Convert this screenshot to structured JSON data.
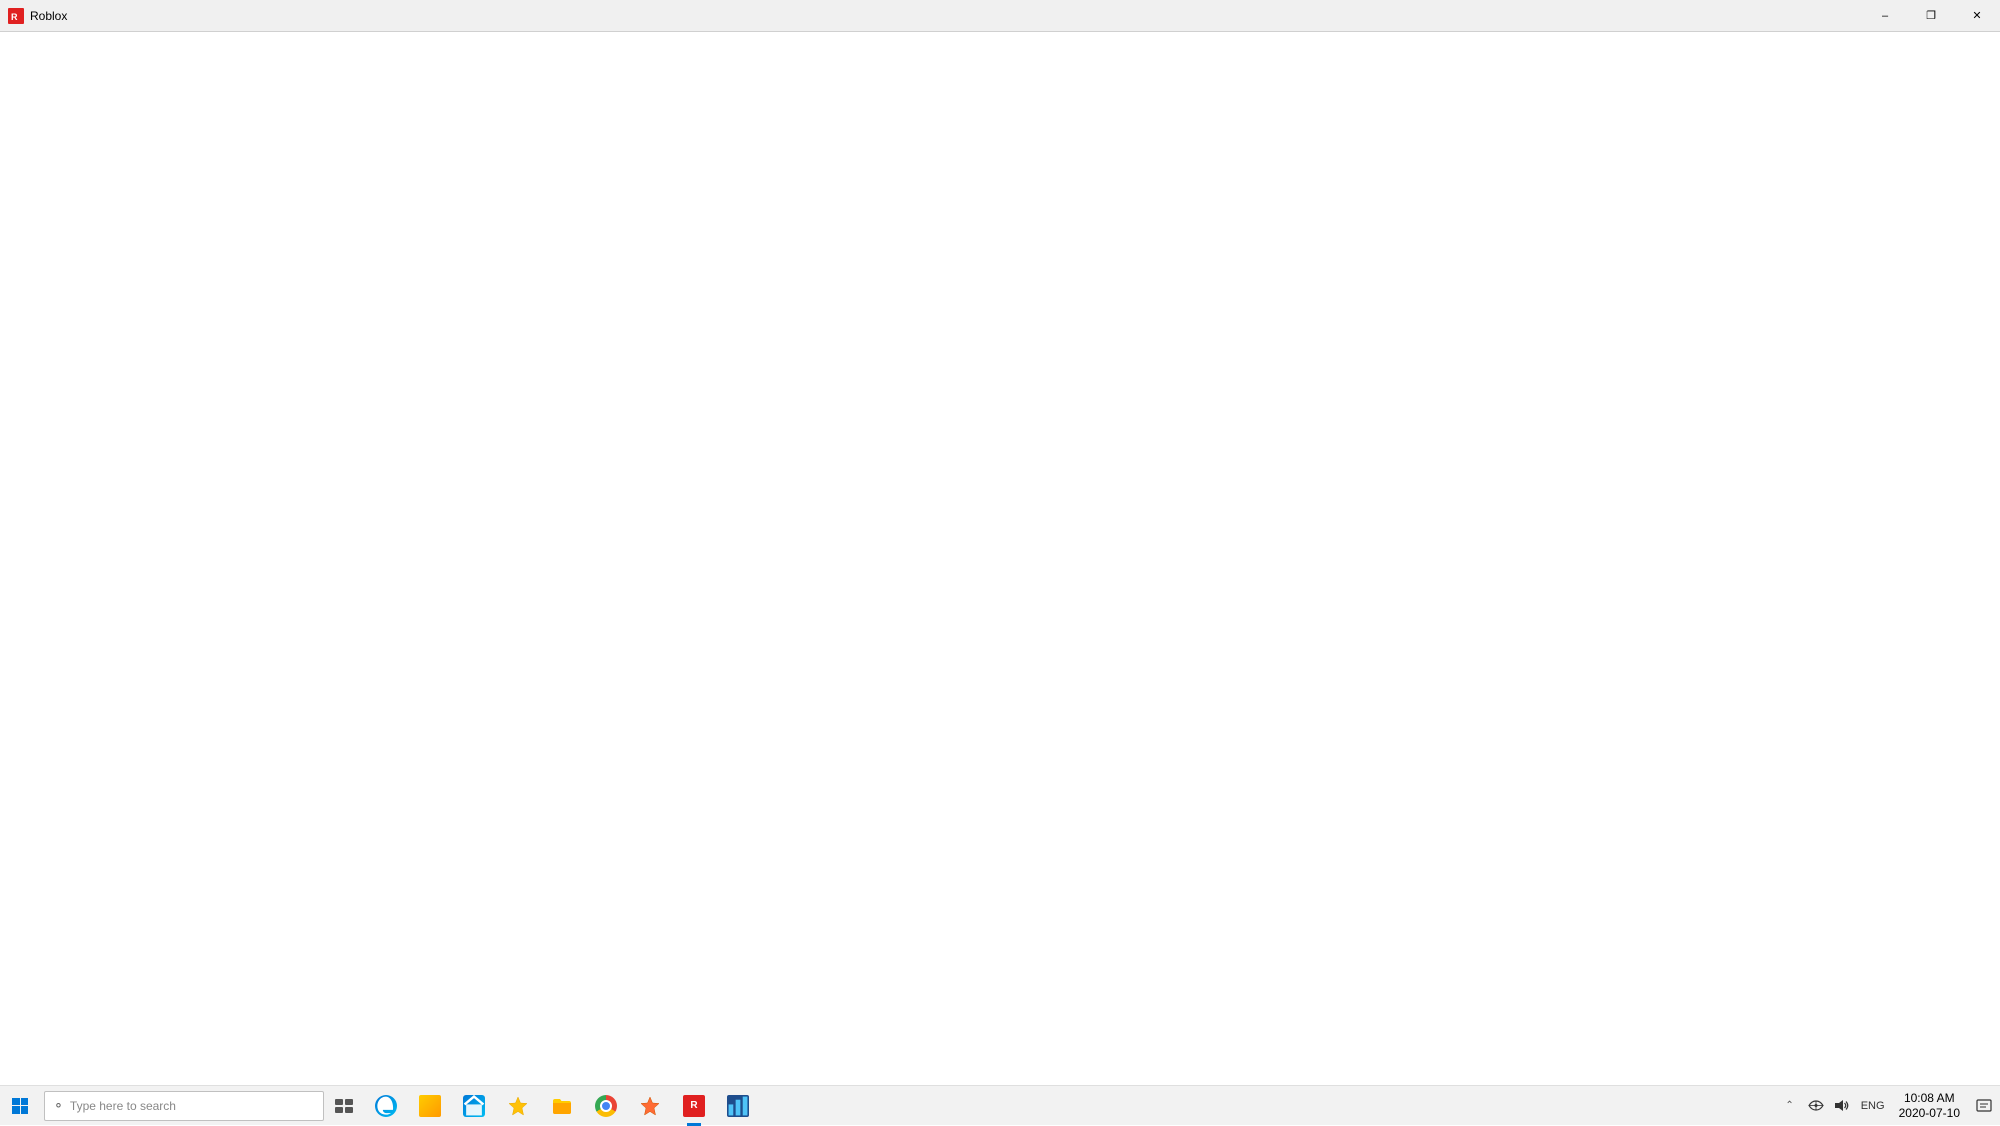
{
  "titlebar": {
    "title": "Roblox",
    "minimize_label": "–",
    "restore_label": "❐",
    "close_label": "✕"
  },
  "main": {
    "background": "#ffffff"
  },
  "taskbar": {
    "search_placeholder": "Type here to search",
    "lang": "ENG",
    "clock": {
      "time": "10:08 AM",
      "date": "2020-07-10"
    },
    "apps": [
      {
        "id": "cortana",
        "label": "Cortana",
        "active": false
      },
      {
        "id": "task-view",
        "label": "Task View",
        "active": false
      },
      {
        "id": "edge",
        "label": "Microsoft Edge",
        "active": false
      },
      {
        "id": "file-explorer",
        "label": "File Explorer",
        "active": false
      },
      {
        "id": "store",
        "label": "Microsoft Store",
        "active": false
      },
      {
        "id": "bookmarks",
        "label": "Bookmarks",
        "active": false
      },
      {
        "id": "file-manager",
        "label": "File Manager",
        "active": false
      },
      {
        "id": "chrome",
        "label": "Google Chrome",
        "active": false
      },
      {
        "id": "bookmarks2",
        "label": "Bookmarks2",
        "active": false
      },
      {
        "id": "roblox",
        "label": "Roblox",
        "active": true
      },
      {
        "id": "blue-app",
        "label": "App",
        "active": false
      }
    ],
    "tray": {
      "chevron": "^",
      "network": "network",
      "volume": "volume",
      "lang": "ENG",
      "notification": "notification"
    }
  }
}
